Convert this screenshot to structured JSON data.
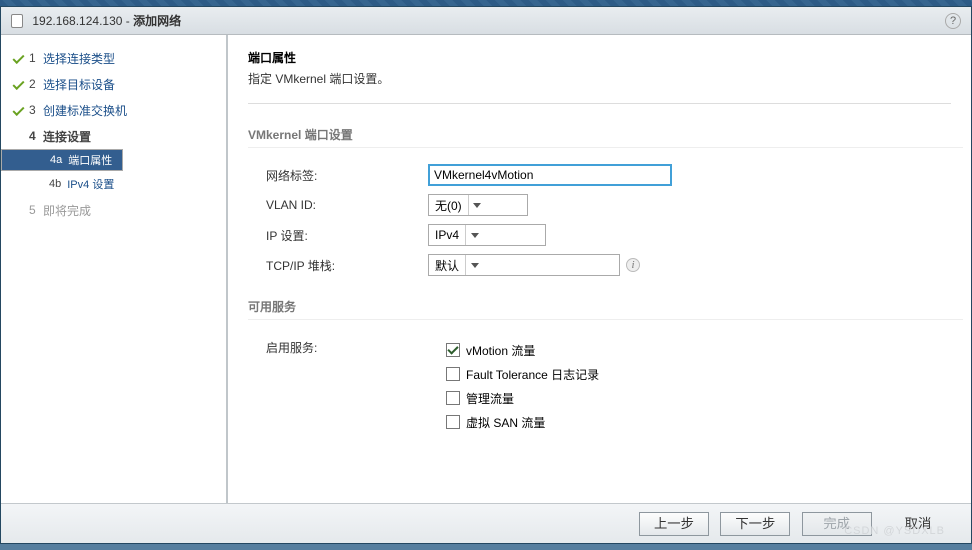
{
  "window": {
    "ip": "192.168.124.130",
    "title": "添加网络"
  },
  "steps": {
    "s1": "选择连接类型",
    "s2": "选择目标设备",
    "s3": "创建标准交换机",
    "s4": "连接设置",
    "s4a": "端口属性",
    "s4b": "IPv4 设置",
    "s5": "即将完成"
  },
  "desc": {
    "heading": "端口属性",
    "sub": "指定 VMkernel 端口设置。"
  },
  "section": {
    "vmk": "VMkernel 端口设置",
    "svc": "可用服务"
  },
  "form": {
    "netlabel": {
      "label": "网络标签:",
      "value": "VMkernel4vMotion"
    },
    "vlan": {
      "label": "VLAN ID:",
      "value": "无(0)"
    },
    "ip": {
      "label": "IP 设置:",
      "value": "IPv4"
    },
    "tcpip": {
      "label": "TCP/IP 堆栈:",
      "value": "默认"
    },
    "enable": {
      "label": "启用服务:"
    },
    "svc1": "vMotion 流量",
    "svc2": "Fault Tolerance 日志记录",
    "svc3": "管理流量",
    "svc4": "虚拟 SAN 流量"
  },
  "footer": {
    "back": "上一步",
    "next": "下一步",
    "finish": "完成",
    "cancel": "取消"
  },
  "watermark": "CSDN @YSDXLB"
}
